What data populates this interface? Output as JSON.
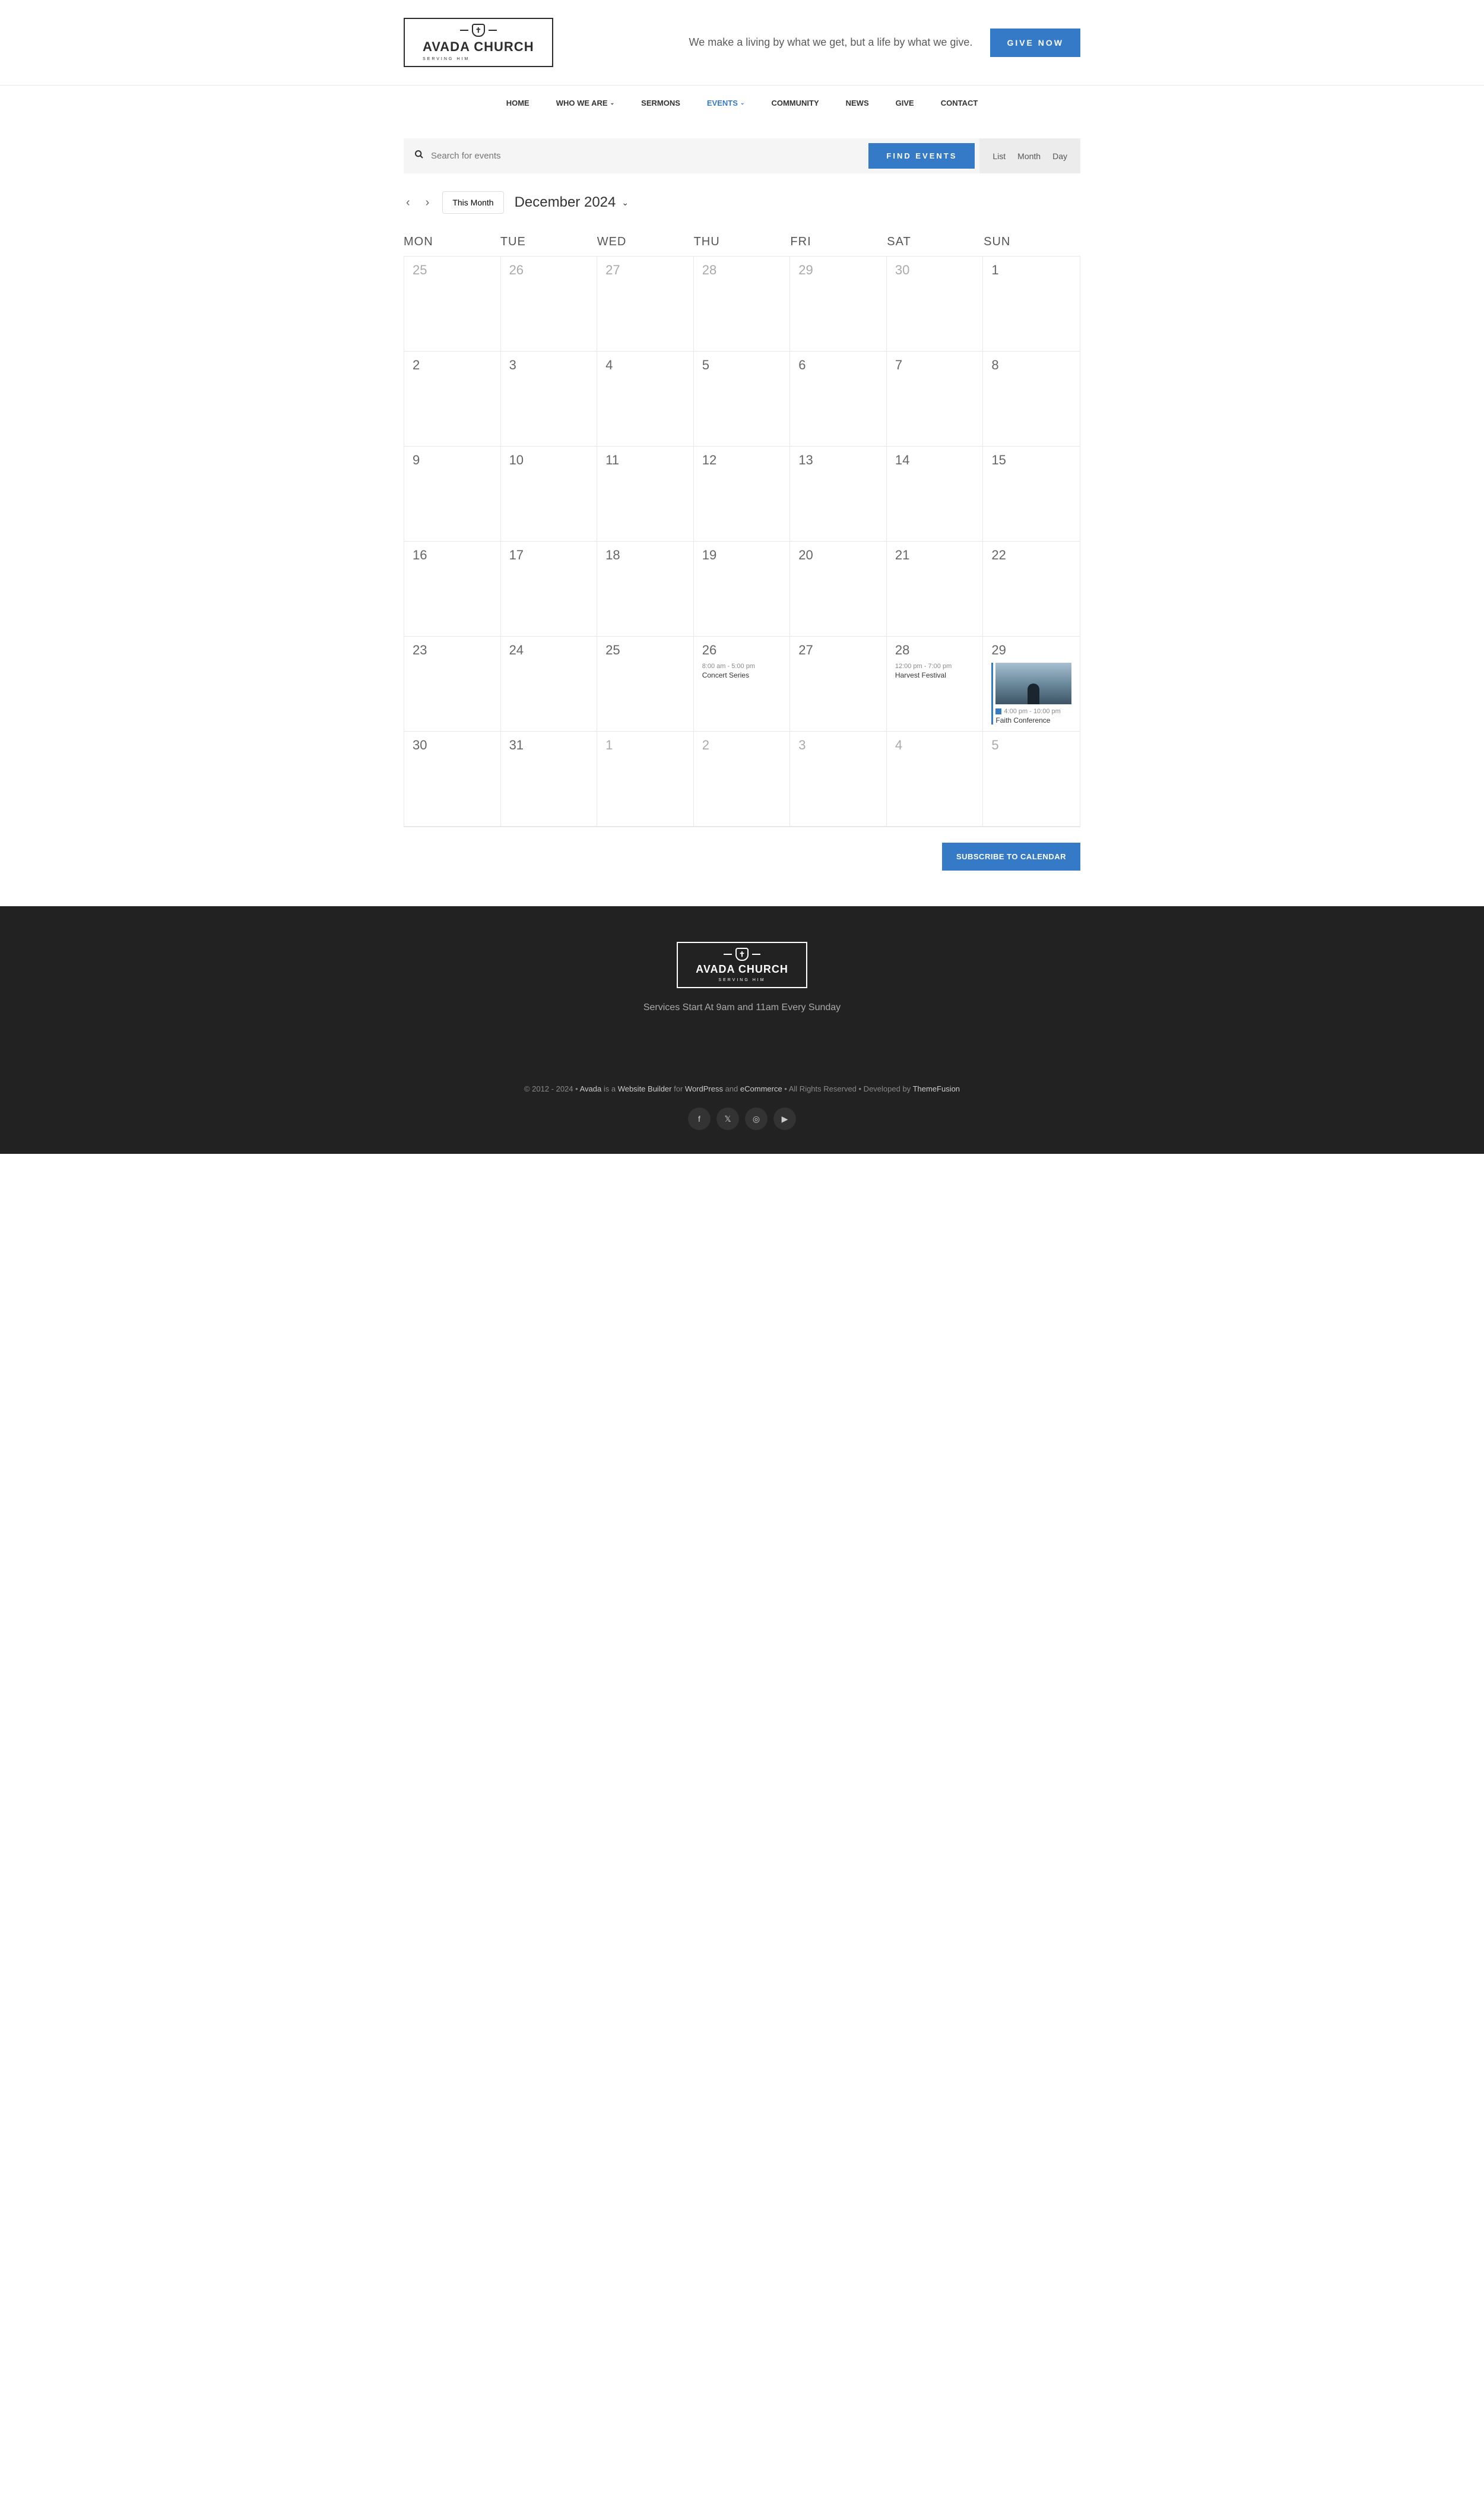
{
  "header": {
    "logo": {
      "title": "AVADA CHURCH",
      "sub": "SERVING HIM"
    },
    "tagline": "We make a living by what we get, but a life by what we give.",
    "give_button": "GIVE NOW"
  },
  "nav": {
    "items": [
      {
        "label": "HOME",
        "active": false,
        "dropdown": false
      },
      {
        "label": "WHO WE ARE",
        "active": false,
        "dropdown": true
      },
      {
        "label": "SERMONS",
        "active": false,
        "dropdown": false
      },
      {
        "label": "EVENTS",
        "active": true,
        "dropdown": true
      },
      {
        "label": "COMMUNITY",
        "active": false,
        "dropdown": false
      },
      {
        "label": "NEWS",
        "active": false,
        "dropdown": false
      },
      {
        "label": "GIVE",
        "active": false,
        "dropdown": false
      },
      {
        "label": "CONTACT",
        "active": false,
        "dropdown": false
      }
    ]
  },
  "search": {
    "placeholder": "Search for events",
    "find_button": "FIND EVENTS",
    "views": {
      "list": "List",
      "month": "Month",
      "day": "Day"
    }
  },
  "controls": {
    "this_month": "This Month",
    "current_label": "December 2024"
  },
  "calendar": {
    "day_headers": [
      "MON",
      "TUE",
      "WED",
      "THU",
      "FRI",
      "SAT",
      "SUN"
    ],
    "weeks": [
      [
        {
          "date": "25",
          "other": true
        },
        {
          "date": "26",
          "other": true
        },
        {
          "date": "27",
          "other": true
        },
        {
          "date": "28",
          "other": true
        },
        {
          "date": "29",
          "other": true
        },
        {
          "date": "30",
          "other": true
        },
        {
          "date": "1",
          "other": false
        }
      ],
      [
        {
          "date": "2"
        },
        {
          "date": "3"
        },
        {
          "date": "4"
        },
        {
          "date": "5"
        },
        {
          "date": "6"
        },
        {
          "date": "7"
        },
        {
          "date": "8"
        }
      ],
      [
        {
          "date": "9"
        },
        {
          "date": "10"
        },
        {
          "date": "11"
        },
        {
          "date": "12"
        },
        {
          "date": "13"
        },
        {
          "date": "14"
        },
        {
          "date": "15"
        }
      ],
      [
        {
          "date": "16"
        },
        {
          "date": "17"
        },
        {
          "date": "18"
        },
        {
          "date": "19"
        },
        {
          "date": "20"
        },
        {
          "date": "21"
        },
        {
          "date": "22"
        }
      ],
      [
        {
          "date": "23"
        },
        {
          "date": "24"
        },
        {
          "date": "25"
        },
        {
          "date": "26",
          "events": [
            {
              "time": "8:00 am - 5:00 pm",
              "title": "Concert Series"
            }
          ]
        },
        {
          "date": "27"
        },
        {
          "date": "28",
          "events": [
            {
              "time": "12:00 pm - 7:00 pm",
              "title": "Harvest Festival"
            }
          ]
        },
        {
          "date": "29",
          "events": [
            {
              "time": "4:00 pm - 10:00 pm",
              "title": "Faith Conference",
              "featured": true,
              "image": true
            }
          ]
        }
      ],
      [
        {
          "date": "30"
        },
        {
          "date": "31"
        },
        {
          "date": "1",
          "other": true
        },
        {
          "date": "2",
          "other": true
        },
        {
          "date": "3",
          "other": true
        },
        {
          "date": "4",
          "other": true
        },
        {
          "date": "5",
          "other": true
        }
      ]
    ]
  },
  "subscribe_button": "SUBSCRIBE TO CALENDAR",
  "footer": {
    "service_time": "Services Start At 9am and 11am Every Sunday",
    "copyright_prefix": "© 2012 - 2024 • ",
    "avada": "Avada",
    "is_a": " is a ",
    "website_builder": "Website Builder",
    "for": " for ",
    "wordpress": "WordPress",
    "and": " and ",
    "ecommerce": "eCommerce",
    "rights": " • All Rights Reserved • Developed by ",
    "themefusion": "ThemeFusion",
    "socials": [
      "facebook",
      "x-twitter",
      "instagram",
      "youtube"
    ]
  }
}
